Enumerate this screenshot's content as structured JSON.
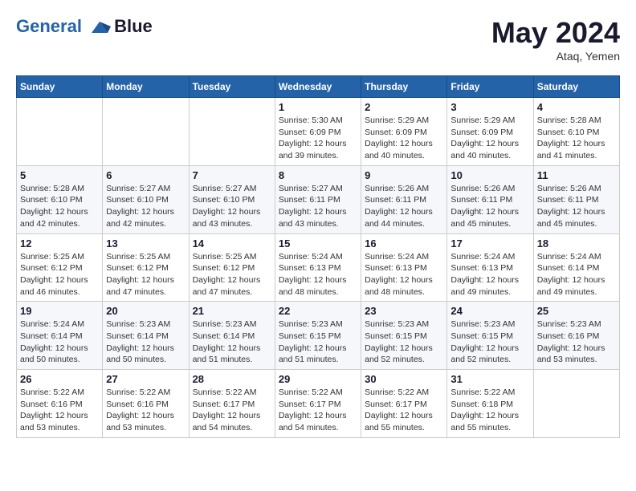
{
  "header": {
    "logo_line1": "General",
    "logo_line2": "Blue",
    "month_year": "May 2024",
    "location": "Ataq, Yemen"
  },
  "weekdays": [
    "Sunday",
    "Monday",
    "Tuesday",
    "Wednesday",
    "Thursday",
    "Friday",
    "Saturday"
  ],
  "weeks": [
    [
      {
        "day": "",
        "info": ""
      },
      {
        "day": "",
        "info": ""
      },
      {
        "day": "",
        "info": ""
      },
      {
        "day": "1",
        "info": "Sunrise: 5:30 AM\nSunset: 6:09 PM\nDaylight: 12 hours\nand 39 minutes."
      },
      {
        "day": "2",
        "info": "Sunrise: 5:29 AM\nSunset: 6:09 PM\nDaylight: 12 hours\nand 40 minutes."
      },
      {
        "day": "3",
        "info": "Sunrise: 5:29 AM\nSunset: 6:09 PM\nDaylight: 12 hours\nand 40 minutes."
      },
      {
        "day": "4",
        "info": "Sunrise: 5:28 AM\nSunset: 6:10 PM\nDaylight: 12 hours\nand 41 minutes."
      }
    ],
    [
      {
        "day": "5",
        "info": "Sunrise: 5:28 AM\nSunset: 6:10 PM\nDaylight: 12 hours\nand 42 minutes."
      },
      {
        "day": "6",
        "info": "Sunrise: 5:27 AM\nSunset: 6:10 PM\nDaylight: 12 hours\nand 42 minutes."
      },
      {
        "day": "7",
        "info": "Sunrise: 5:27 AM\nSunset: 6:10 PM\nDaylight: 12 hours\nand 43 minutes."
      },
      {
        "day": "8",
        "info": "Sunrise: 5:27 AM\nSunset: 6:11 PM\nDaylight: 12 hours\nand 43 minutes."
      },
      {
        "day": "9",
        "info": "Sunrise: 5:26 AM\nSunset: 6:11 PM\nDaylight: 12 hours\nand 44 minutes."
      },
      {
        "day": "10",
        "info": "Sunrise: 5:26 AM\nSunset: 6:11 PM\nDaylight: 12 hours\nand 45 minutes."
      },
      {
        "day": "11",
        "info": "Sunrise: 5:26 AM\nSunset: 6:11 PM\nDaylight: 12 hours\nand 45 minutes."
      }
    ],
    [
      {
        "day": "12",
        "info": "Sunrise: 5:25 AM\nSunset: 6:12 PM\nDaylight: 12 hours\nand 46 minutes."
      },
      {
        "day": "13",
        "info": "Sunrise: 5:25 AM\nSunset: 6:12 PM\nDaylight: 12 hours\nand 47 minutes."
      },
      {
        "day": "14",
        "info": "Sunrise: 5:25 AM\nSunset: 6:12 PM\nDaylight: 12 hours\nand 47 minutes."
      },
      {
        "day": "15",
        "info": "Sunrise: 5:24 AM\nSunset: 6:13 PM\nDaylight: 12 hours\nand 48 minutes."
      },
      {
        "day": "16",
        "info": "Sunrise: 5:24 AM\nSunset: 6:13 PM\nDaylight: 12 hours\nand 48 minutes."
      },
      {
        "day": "17",
        "info": "Sunrise: 5:24 AM\nSunset: 6:13 PM\nDaylight: 12 hours\nand 49 minutes."
      },
      {
        "day": "18",
        "info": "Sunrise: 5:24 AM\nSunset: 6:14 PM\nDaylight: 12 hours\nand 49 minutes."
      }
    ],
    [
      {
        "day": "19",
        "info": "Sunrise: 5:24 AM\nSunset: 6:14 PM\nDaylight: 12 hours\nand 50 minutes."
      },
      {
        "day": "20",
        "info": "Sunrise: 5:23 AM\nSunset: 6:14 PM\nDaylight: 12 hours\nand 50 minutes."
      },
      {
        "day": "21",
        "info": "Sunrise: 5:23 AM\nSunset: 6:14 PM\nDaylight: 12 hours\nand 51 minutes."
      },
      {
        "day": "22",
        "info": "Sunrise: 5:23 AM\nSunset: 6:15 PM\nDaylight: 12 hours\nand 51 minutes."
      },
      {
        "day": "23",
        "info": "Sunrise: 5:23 AM\nSunset: 6:15 PM\nDaylight: 12 hours\nand 52 minutes."
      },
      {
        "day": "24",
        "info": "Sunrise: 5:23 AM\nSunset: 6:15 PM\nDaylight: 12 hours\nand 52 minutes."
      },
      {
        "day": "25",
        "info": "Sunrise: 5:23 AM\nSunset: 6:16 PM\nDaylight: 12 hours\nand 53 minutes."
      }
    ],
    [
      {
        "day": "26",
        "info": "Sunrise: 5:22 AM\nSunset: 6:16 PM\nDaylight: 12 hours\nand 53 minutes."
      },
      {
        "day": "27",
        "info": "Sunrise: 5:22 AM\nSunset: 6:16 PM\nDaylight: 12 hours\nand 53 minutes."
      },
      {
        "day": "28",
        "info": "Sunrise: 5:22 AM\nSunset: 6:17 PM\nDaylight: 12 hours\nand 54 minutes."
      },
      {
        "day": "29",
        "info": "Sunrise: 5:22 AM\nSunset: 6:17 PM\nDaylight: 12 hours\nand 54 minutes."
      },
      {
        "day": "30",
        "info": "Sunrise: 5:22 AM\nSunset: 6:17 PM\nDaylight: 12 hours\nand 55 minutes."
      },
      {
        "day": "31",
        "info": "Sunrise: 5:22 AM\nSunset: 6:18 PM\nDaylight: 12 hours\nand 55 minutes."
      },
      {
        "day": "",
        "info": ""
      }
    ]
  ]
}
